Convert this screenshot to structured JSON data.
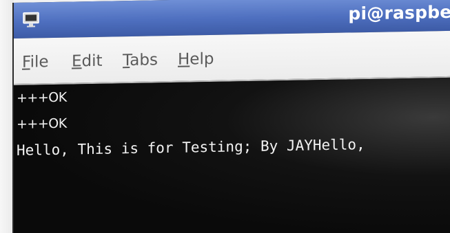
{
  "window": {
    "title": "pi@raspber"
  },
  "menu": {
    "items": [
      {
        "mnemonic": "F",
        "rest": "ile"
      },
      {
        "mnemonic": "E",
        "rest": "dit"
      },
      {
        "mnemonic": "T",
        "rest": "abs"
      },
      {
        "mnemonic": "H",
        "rest": "elp"
      }
    ]
  },
  "terminal": {
    "lines": [
      "+++OK",
      "+++OK",
      "Hello, This is for Testing; By JAYHello,"
    ]
  },
  "colors": {
    "titlebar": "#4e6fbf",
    "menubar": "#ececec",
    "terminal_bg": "#0e0e0e",
    "terminal_text": "#f2f2f2"
  },
  "icons": {
    "title_icon": "terminal-monitor-icon"
  }
}
